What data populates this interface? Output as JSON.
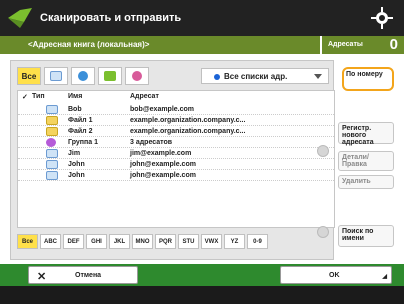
{
  "window": {
    "title": "Сканировать и отправить",
    "icon": "scan-send-icon"
  },
  "address_bar": {
    "label": "<Адресная книга (локальная)>",
    "count_label": "Адресаты",
    "count_value": "0"
  },
  "filters": {
    "buttons": [
      {
        "label": "Все",
        "selected": true,
        "icon": "all-label"
      },
      {
        "label": "",
        "selected": false,
        "icon": "email-icon"
      },
      {
        "label": "",
        "selected": false,
        "icon": "globe-icon"
      },
      {
        "label": "",
        "selected": false,
        "icon": "i-fax-icon"
      },
      {
        "label": "",
        "selected": false,
        "icon": "group-icon"
      }
    ],
    "dropdown": {
      "label": "Все списки адр.",
      "icon": "dot-icon"
    }
  },
  "list": {
    "headers": {
      "type": "Тип",
      "name": "Имя",
      "address": "Адресат"
    },
    "rows": [
      {
        "icon": "email-icon",
        "name": "Bob",
        "address": "bob@example.com"
      },
      {
        "icon": "file-icon",
        "name": "Файл 1",
        "address": "example.organization.company.c..."
      },
      {
        "icon": "file-icon",
        "name": "Файл 2",
        "address": "example.organization.company.c..."
      },
      {
        "icon": "group-icon",
        "name": "Группа 1",
        "address": "3 адресатов"
      },
      {
        "icon": "email-icon",
        "name": "Jim",
        "address": "jim@example.com"
      },
      {
        "icon": "email-icon",
        "name": "John",
        "address": "john@example.com"
      },
      {
        "icon": "email-icon",
        "name": "John",
        "address": "john@example.com"
      }
    ]
  },
  "alpha": [
    "Все",
    "ABC",
    "DEF",
    "GHI",
    "JKL",
    "MNO",
    "PQR",
    "STU",
    "VWX",
    "YZ",
    "0-9"
  ],
  "right": {
    "by_number": "По номеру",
    "register": "Регистр. нового адресата",
    "details": "Детали/Правка",
    "delete": "Удалить",
    "search": "Поиск по имени"
  },
  "bottom": {
    "cancel": "Отмена",
    "ok": "OK"
  },
  "colors": {
    "accent_green": "#2e8a2e",
    "addr_green": "#6a8a2a",
    "highlight_orange": "#f3a51b",
    "yellow": "#ffe04a"
  }
}
